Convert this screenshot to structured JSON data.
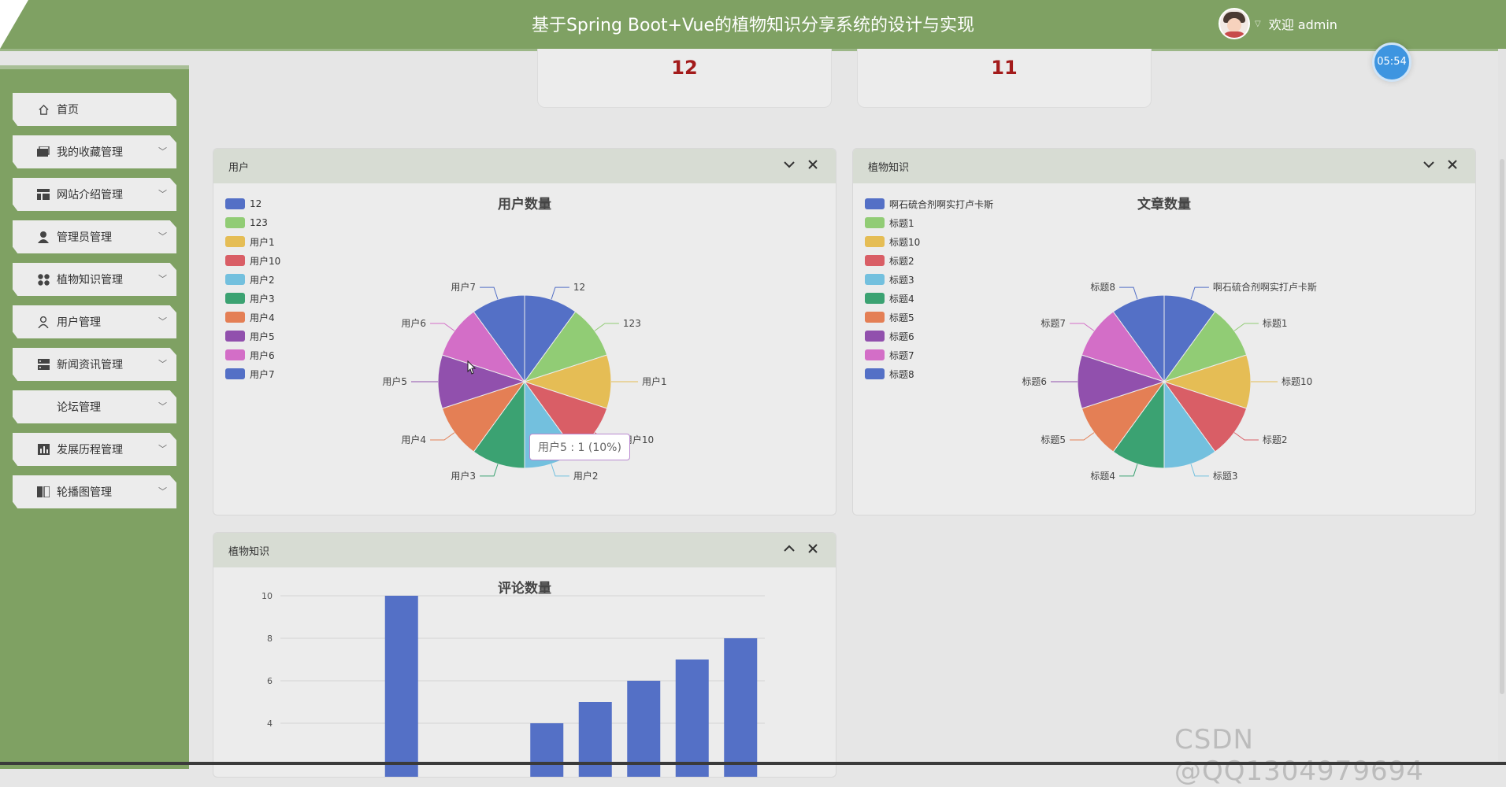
{
  "header": {
    "title": "基于Spring Boot+Vue的植物知识分享系统的设计与实现",
    "welcome": "欢迎 admin"
  },
  "timer": "05:54",
  "sidebar": {
    "items": [
      {
        "label": "首页",
        "icon": "home-icon"
      },
      {
        "label": "我的收藏管理",
        "icon": "folder-icon"
      },
      {
        "label": "网站介绍管理",
        "icon": "layout-icon"
      },
      {
        "label": "管理员管理",
        "icon": "person-icon"
      },
      {
        "label": "植物知识管理",
        "icon": "grid-icon"
      },
      {
        "label": "用户管理",
        "icon": "user-outline-icon"
      },
      {
        "label": "新闻资讯管理",
        "icon": "server-icon"
      },
      {
        "label": "论坛管理",
        "icon": ""
      },
      {
        "label": "发展历程管理",
        "icon": "bar-chart-icon"
      },
      {
        "label": "轮播图管理",
        "icon": "columns-icon"
      }
    ]
  },
  "stats": {
    "card1": "12",
    "card2": "11"
  },
  "panels": {
    "users": {
      "title": "用户"
    },
    "plant_articles": {
      "title": "植物知识"
    },
    "plant_comments": {
      "title": "植物知识"
    }
  },
  "colors": {
    "palette": [
      "#5470c6",
      "#91cc75",
      "#e5bd55",
      "#d95e66",
      "#73c0de",
      "#3ba272",
      "#e47f55",
      "#9150ad",
      "#d36ec7",
      "#5470c6"
    ],
    "header": "#7fa163",
    "stat_number": "#a31b1b"
  },
  "tooltip": "用户5 : 1 (10%)",
  "watermark": "CSDN @QQ1304979694",
  "chart_data": [
    {
      "type": "pie",
      "title": "用户数量",
      "labels": [
        "12",
        "123",
        "用户1",
        "用户10",
        "用户2",
        "用户3",
        "用户4",
        "用户5",
        "用户6",
        "用户7"
      ],
      "values": [
        1,
        1,
        1,
        1,
        1,
        1,
        1,
        1,
        1,
        1
      ],
      "legend_position": "top-left"
    },
    {
      "type": "pie",
      "title": "文章数量",
      "labels": [
        "啊石硫合剂啊实打卢卡斯",
        "标题1",
        "标题10",
        "标题2",
        "标题3",
        "标题4",
        "标题5",
        "标题6",
        "标题7",
        "标题8"
      ],
      "values": [
        1,
        1,
        1,
        1,
        1,
        1,
        1,
        1,
        1,
        1
      ],
      "legend_position": "top-left"
    },
    {
      "type": "bar",
      "title": "评论数量",
      "categories": [
        "",
        "",
        "",
        "",
        "",
        "",
        "",
        "",
        "",
        ""
      ],
      "values": [
        0,
        0,
        10,
        0,
        0,
        4,
        5,
        6,
        7,
        8
      ],
      "y_ticks": [
        "10",
        "8",
        "6",
        "4"
      ],
      "ylim": [
        0,
        10
      ],
      "grid": true
    }
  ]
}
